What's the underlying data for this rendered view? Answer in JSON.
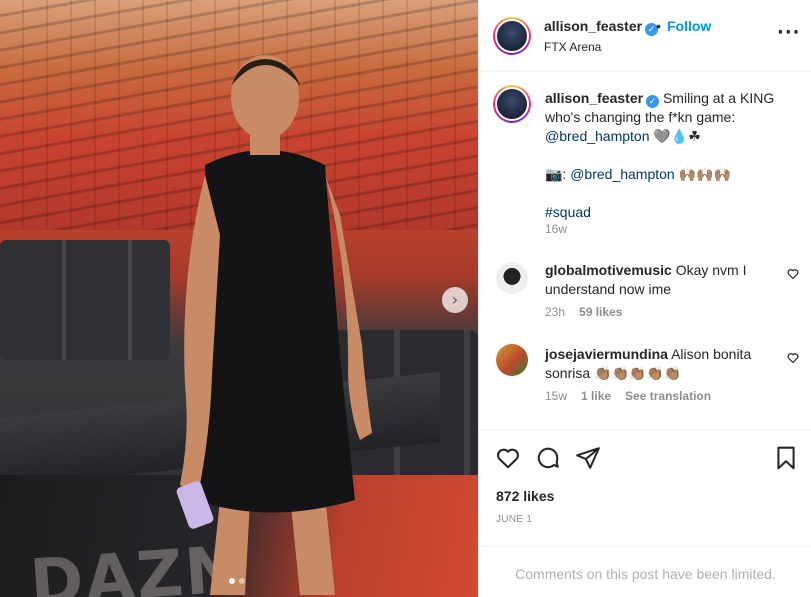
{
  "post": {
    "username": "allison_feaster",
    "follow_label": "Follow",
    "separator": "•",
    "location": "FTX Arena",
    "more_label": "···"
  },
  "media": {
    "ad_text": "DAZN",
    "nav_next": "›"
  },
  "caption": {
    "username": "allison_feaster",
    "line1": "Smiling at a KING who's changing the f*kn game:",
    "mention1": "@bred_hampton",
    "emoji1": "🩶💧☘",
    "credit_prefix": "📷: ",
    "mention2": "@bred_hampton",
    "emoji2": "🙌🏽🙌🏽🙌🏽",
    "hashtag": "#squad",
    "time": "16w"
  },
  "comments": [
    {
      "username": "globalmotivemusic",
      "text": "Okay nvm I understand now ime",
      "time": "23h",
      "likes": "59 likes"
    },
    {
      "username": "josejaviermundina",
      "text": "Alison bonita sonrisa 👏🏽👏🏽👏🏽👏🏽👏🏽",
      "time": "15w",
      "likes": "1 like",
      "translate": "See translation"
    }
  ],
  "actions": {
    "likes": "872 likes",
    "date": "JUNE 1"
  },
  "footer": {
    "limited": "Comments on this post have been limited."
  },
  "colors": {
    "accent": "#0095f6",
    "link": "#00376b",
    "muted": "#8e8e8e"
  }
}
